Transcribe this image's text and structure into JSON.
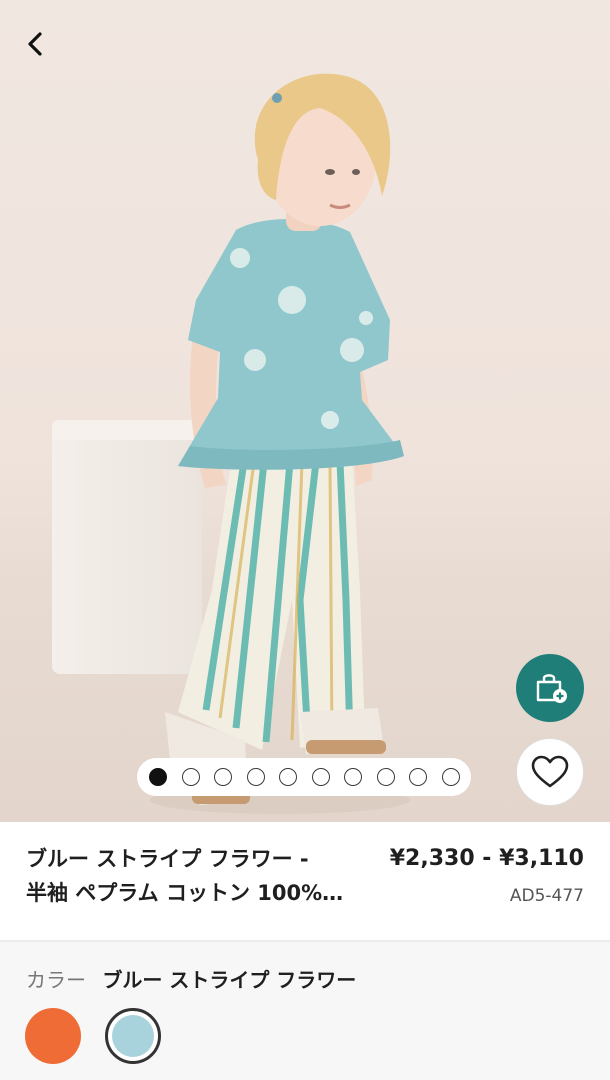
{
  "product": {
    "title_line1": "ブルー ストライプ フラワー -",
    "title_line2": "半袖 ペプラム コットン 100%…",
    "price": "¥2,330 - ¥3,110",
    "code": "AD5-477"
  },
  "gallery": {
    "total_images": 10,
    "active_index": 0
  },
  "colors": {
    "label": "カラー",
    "selected_name": "ブルー ストライプ フラワー",
    "swatches": [
      {
        "name": "orange",
        "hex": "#ef6c37"
      },
      {
        "name": "blue",
        "hex": "#a9d3dc"
      }
    ]
  },
  "icons": {
    "back": "chevron-left-icon",
    "bag": "shopping-bag-plus-icon",
    "favorite": "heart-outline-icon"
  },
  "theme": {
    "accent": "#1f7f78"
  }
}
